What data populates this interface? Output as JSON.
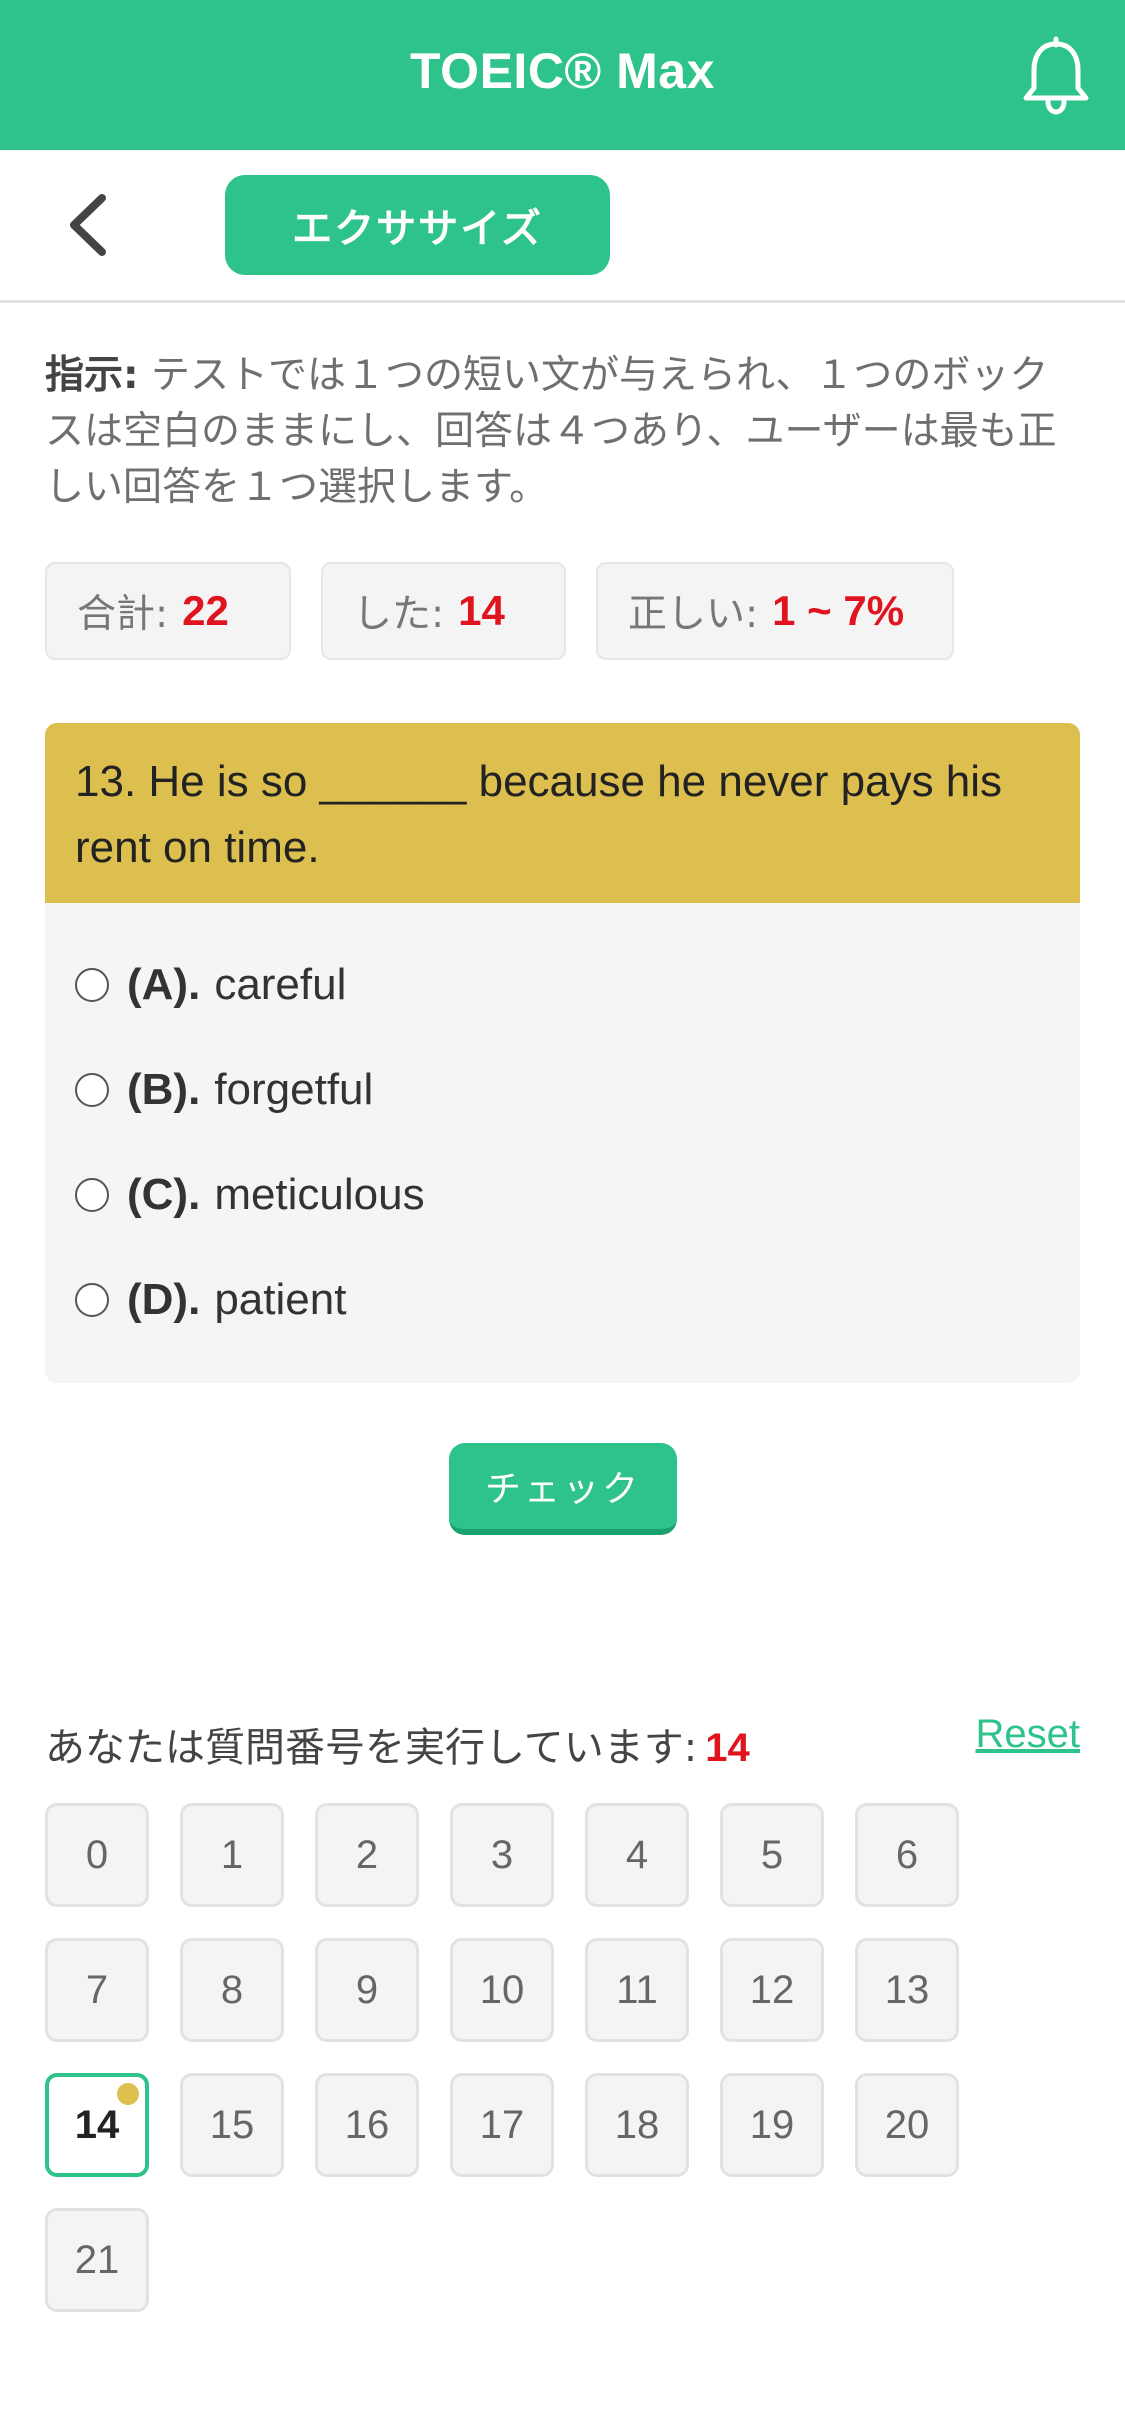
{
  "header": {
    "title": "TOEIC® Max"
  },
  "subnav": {
    "tab_label": "エクササイズ"
  },
  "instructions": {
    "label": "指示:",
    "text": " テストでは１つの短い文が与えられ、１つのボックスは空白のままにし、回答は４つあり、ユーザーは最も正しい回答を１つ選択します。"
  },
  "stats": [
    {
      "label": "合計:",
      "value": "22"
    },
    {
      "label": "した:",
      "value": "14"
    },
    {
      "label": "正しい:",
      "value": "1 ~ 7%"
    }
  ],
  "question": {
    "text": "13. He is so ______ because he never pays his rent on time.",
    "options": [
      {
        "key": "(A).",
        "text": "careful"
      },
      {
        "key": "(B).",
        "text": "forgetful"
      },
      {
        "key": "(C).",
        "text": "meticulous"
      },
      {
        "key": "(D).",
        "text": "patient"
      }
    ]
  },
  "check_label": "チェック",
  "progress": {
    "label": "あなたは質問番号を実行しています:",
    "current": "14",
    "reset_label": "Reset"
  },
  "question_numbers": [
    "0",
    "1",
    "2",
    "3",
    "4",
    "5",
    "6",
    "7",
    "8",
    "9",
    "10",
    "11",
    "12",
    "13",
    "14",
    "15",
    "16",
    "17",
    "18",
    "19",
    "20",
    "21"
  ],
  "colors": {
    "primary": "#2dc38b",
    "question_header": "#dcbf4f",
    "highlight": "#e0141e"
  }
}
